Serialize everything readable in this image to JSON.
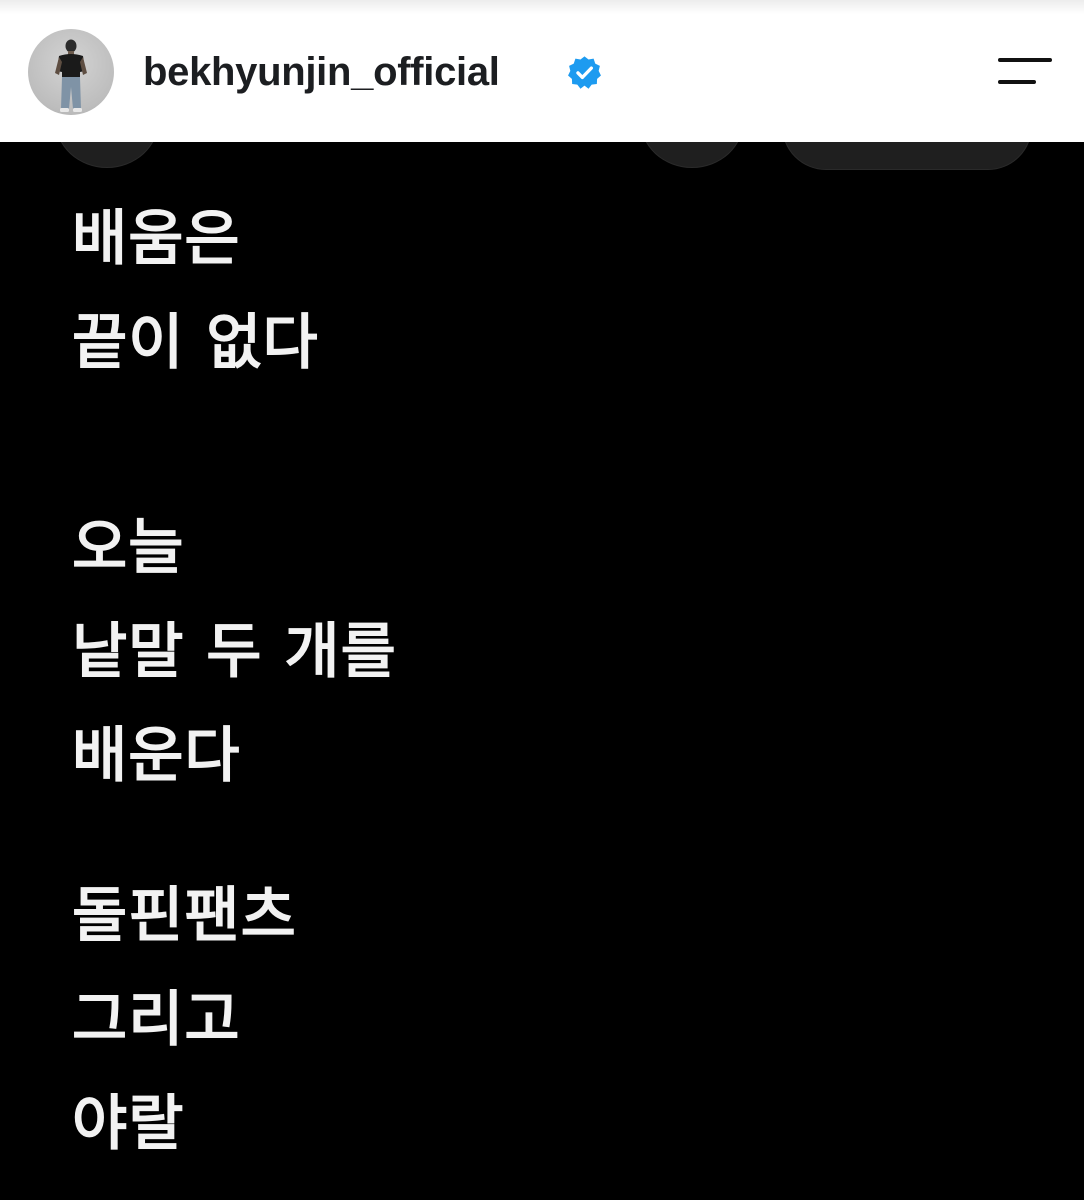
{
  "header": {
    "username": "bekhyunjin_official",
    "avatar_icon": "profile-photo",
    "verified_icon": "verified-badge-icon",
    "menu_icon": "menu-icon"
  },
  "story": {
    "block1": [
      "배움은",
      "끝이 없다"
    ],
    "block2": [
      "오늘",
      "낱말 두 개를",
      "배운다"
    ],
    "block3": [
      "돌핀팬츠",
      "그리고",
      "야랄"
    ]
  },
  "colors": {
    "header_bg": "#ffffff",
    "story_bg": "#000000",
    "story_text": "#f2f2f2",
    "verified_blue": "#1d9bf0",
    "username_text": "#1c1e21"
  }
}
